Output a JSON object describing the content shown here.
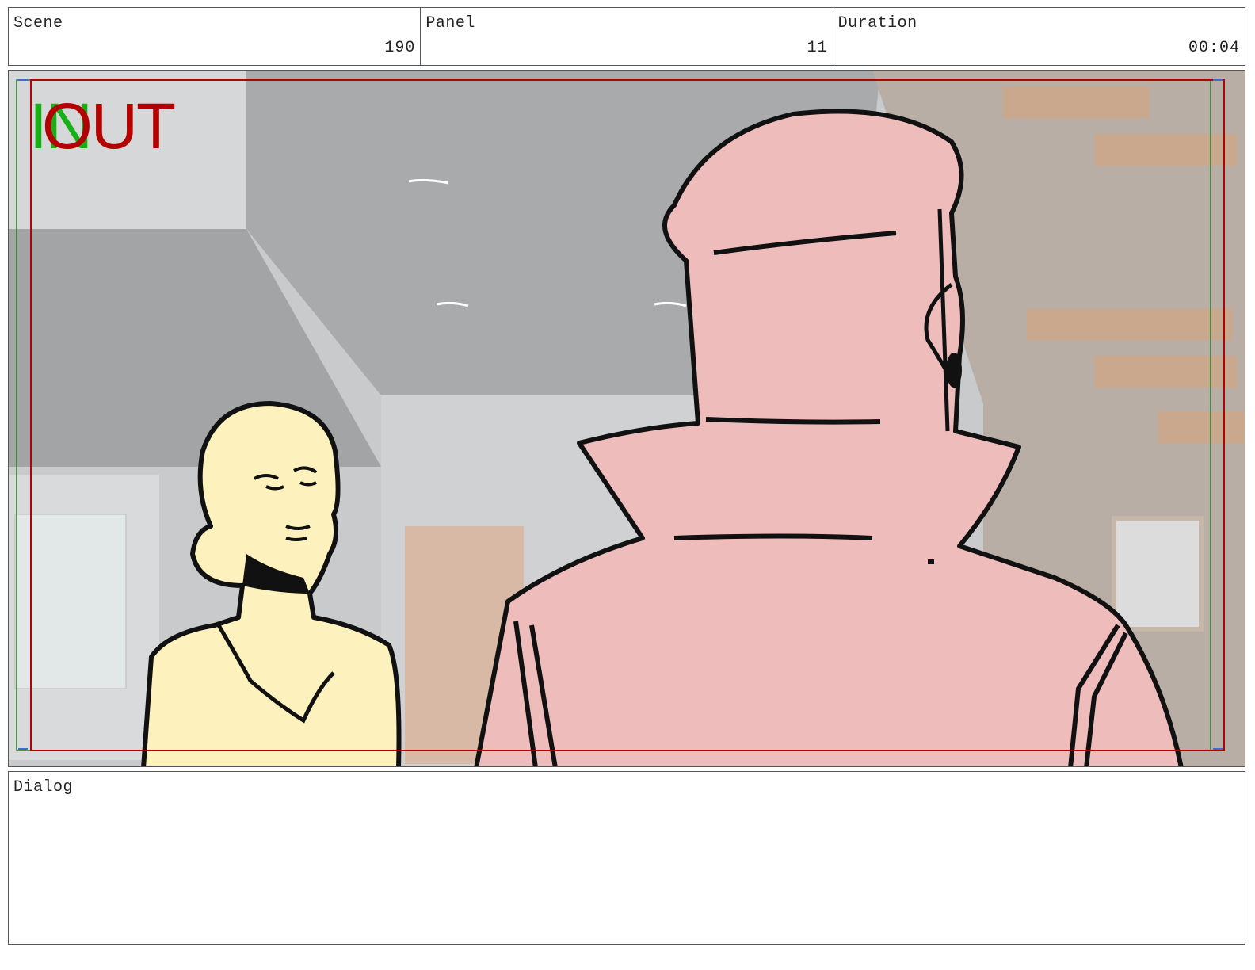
{
  "header": {
    "scene_label": "Scene",
    "scene_value": "190",
    "panel_label": "Panel",
    "panel_value": "11",
    "duration_label": "Duration",
    "duration_value": "00:04"
  },
  "panel_overlay": {
    "in_text": "IN",
    "out_text": "OUT",
    "in_color": "#17b117",
    "out_color": "#b30000",
    "action_safe_color": "#2a7a2a",
    "title_safe_color": "#b30000"
  },
  "artwork": {
    "description_icons": [
      "woman-figure",
      "man-in-coat-figure",
      "interior-background"
    ],
    "colors": {
      "background": "#c7c8ca",
      "woman_fill": "#fdf1bd",
      "man_fill": "#efbcbc",
      "outline": "#111111"
    }
  },
  "dialog": {
    "label": "Dialog",
    "text": ""
  }
}
